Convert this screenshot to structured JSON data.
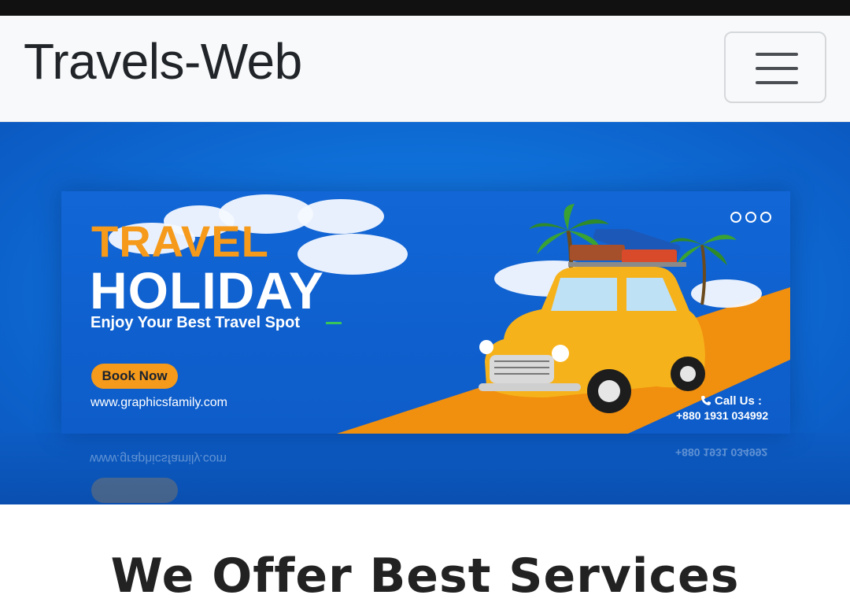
{
  "navbar": {
    "brand": "Travels-Web",
    "toggler_icon": "hamburger-menu-icon"
  },
  "hero": {
    "title_line1": "TRAVEL",
    "title_line2": "HOLIDAY",
    "tagline": "Enjoy Your Best Travel Spot",
    "cta_label": "Book Now",
    "website": "www.graphicsfamily.com",
    "call_label": "Call Us :",
    "phone": "+880 1931 034992",
    "social_icons": [
      "instagram-icon",
      "twitter-icon",
      "facebook-icon"
    ],
    "colors": {
      "accent_orange": "#f59a1a",
      "banner_blue": "#0d5cc9",
      "car_yellow": "#f6b21a"
    }
  },
  "section": {
    "heading": "We Offer Best Services"
  }
}
